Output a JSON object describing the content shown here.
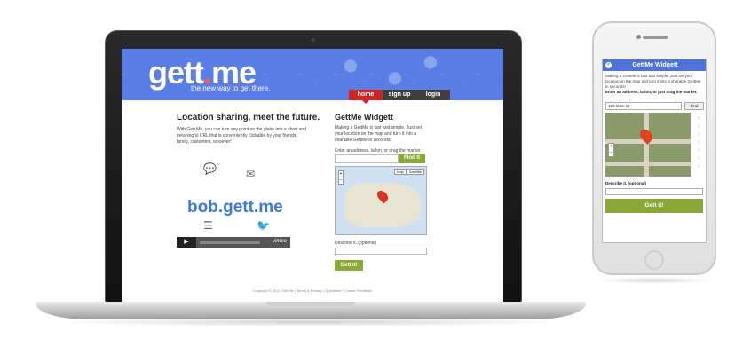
{
  "site": {
    "logo": {
      "main": "gett",
      "dot": ".",
      "suffix": "me"
    },
    "tagline": "the new way to get there.",
    "nav": [
      {
        "label": "home",
        "active": true
      },
      {
        "label": "sign up",
        "active": false
      },
      {
        "label": "login",
        "active": false
      }
    ],
    "hero": {
      "title": "Location sharing, meet the future.",
      "text": "With Gett.Me, you can turn any point on the globe into a short and meaningful URL that is conveniently clickable by your friends, family, customers, whoever!",
      "link": "bob.gett.me",
      "video_brand": "vimeo"
    },
    "widget": {
      "title": "GettMe Widgett",
      "text": "Making a GettMe is fast and simple. Just set your location on the map and turn it into a sharable GettMe in seconds!",
      "prompt": "Enter an address, latlon, or drag the marker.",
      "find_label": "Find it",
      "map_types": [
        "Map",
        "Satellite"
      ],
      "describe_label": "Describe it. (optional)",
      "submit_label": "Gett it!"
    },
    "footer": "Copyright © 2011 Gett.Me  |  Terms & Privacy  |  Questions?  |  Leave Feedback"
  },
  "mobile": {
    "title": "GettMe Widgett",
    "text": "Making a GettMe is fast and simple. Just set your location on the map and turn it into a sharable GettMe in seconds!",
    "prompt": "Enter an address, latlon, or just drag the marker.",
    "address_value": "123 Main St",
    "find_label": "Find",
    "describe_label": "Describe it. (optional)",
    "submit_label": "Gett it!"
  },
  "colors": {
    "header_blue": "#5a7ee6",
    "nav_active": "#d02424",
    "button_green": "#8aa83a",
    "link_blue": "#3b7ad9"
  }
}
